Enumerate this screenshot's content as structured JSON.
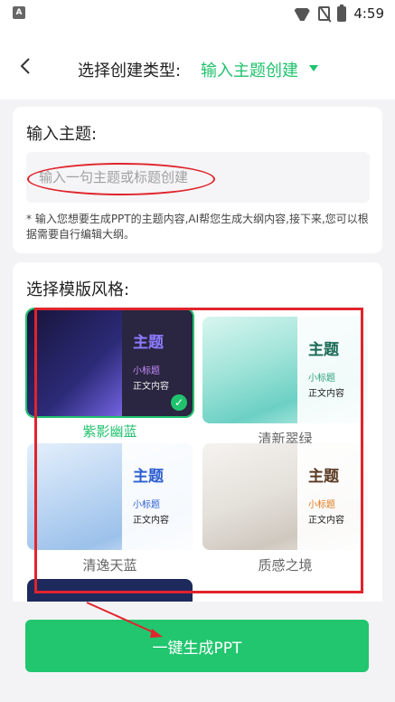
{
  "status_bar": {
    "time": "4:59",
    "left_badge": "A"
  },
  "header": {
    "title": "选择创建类型:",
    "type_value": "输入主题创建"
  },
  "topic": {
    "label": "输入主题:",
    "placeholder": "输入一句主题或标题创建",
    "hint": "* 输入您想要生成PPT的主题内容,AI帮您生成大纲内容,接下来,您可以根据需要自行编辑大纲。"
  },
  "templates": {
    "label": "选择模版风格:",
    "items": [
      {
        "name": "紫影幽蓝",
        "title": "主题",
        "subtitle": "小标题",
        "body": "正文内容",
        "selected": true,
        "title_color": "#8c7cff",
        "sub_color": "#c58cff"
      },
      {
        "name": "清新翠绿",
        "title": "主题",
        "subtitle": "小标题",
        "body": "正文内容",
        "selected": false,
        "title_color": "#1a6a55",
        "sub_color": "#2ea27a"
      },
      {
        "name": "清逸天蓝",
        "title": "主题",
        "subtitle": "小标题",
        "body": "正文内容",
        "selected": false,
        "title_color": "#2d5fd1",
        "sub_color": "#2d5fd1"
      },
      {
        "name": "质感之境",
        "title": "主题",
        "subtitle": "小标题",
        "body": "正文内容",
        "selected": false,
        "title_color": "#5a3a22",
        "sub_color": "#e07a1c"
      }
    ]
  },
  "generate_button": "一键生成PPT",
  "colors": {
    "accent": "#21c26e",
    "annotation": "#e0242c"
  }
}
